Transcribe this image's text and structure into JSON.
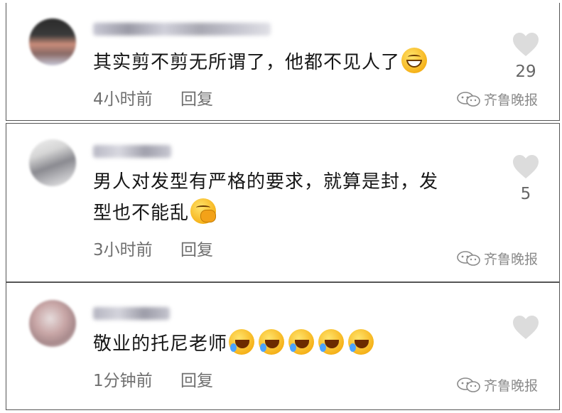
{
  "comments": [
    {
      "text": "其实剪不剪无所谓了，他都不见人了",
      "emoji": "grin-emoji",
      "time": "4小时前",
      "reply_label": "回复",
      "likes": "29",
      "watermark": "齐鲁晚报"
    },
    {
      "text_line1": "男人对发型有严格的要求，就算是封，发",
      "text_line2": "型也不能乱",
      "emoji": "hand-over-mouth-emoji",
      "time": "3小时前",
      "reply_label": "回复",
      "likes": "5",
      "watermark": "齐鲁晚报"
    },
    {
      "text": "敬业的托尼老师",
      "emoji": "rolling-laugh-emoji x5",
      "time": "1分钟前",
      "reply_label": "回复",
      "likes": "",
      "watermark": "齐鲁晚报"
    }
  ],
  "colors": {
    "heart": "#dcdcdc",
    "meta_text": "#6f6f6f",
    "border": "#555555"
  }
}
